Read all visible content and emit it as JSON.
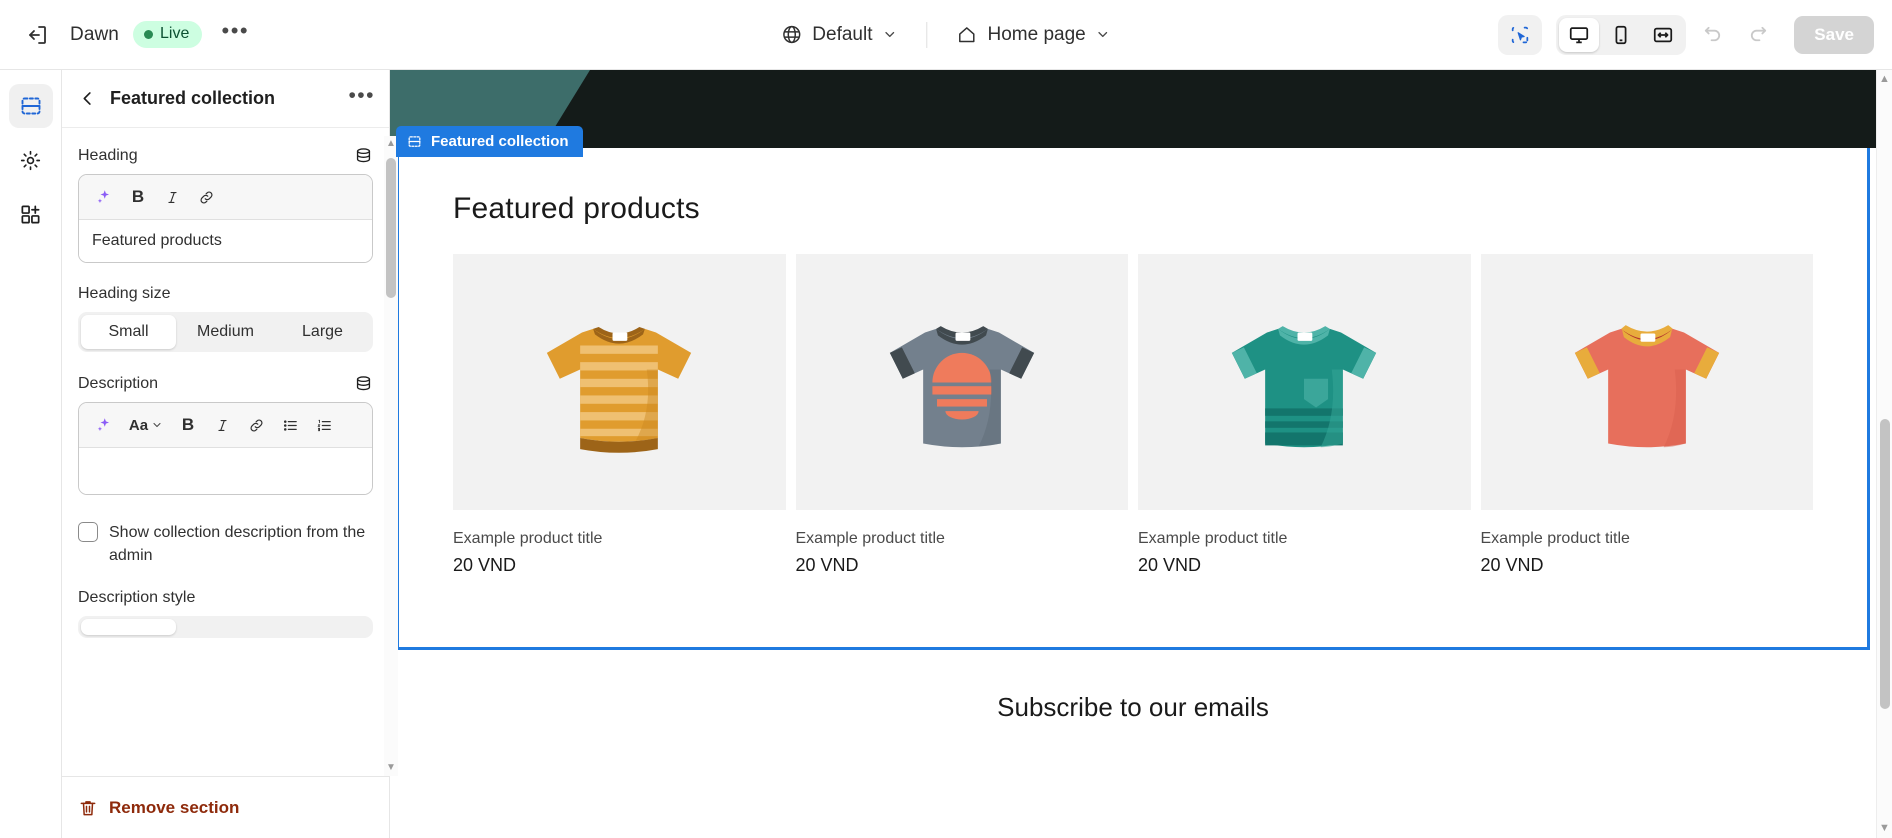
{
  "topbar": {
    "exit_icon": "exit-icon",
    "theme_name": "Dawn",
    "status_badge": "Live",
    "more_menu": "•••",
    "locale_icon": "globe-icon",
    "locale_label": "Default",
    "page_icon": "home-icon",
    "page_label": "Home page",
    "chevron": "⌄",
    "select_tool_icon": "select-tool-icon",
    "device_desktop_icon": "desktop-icon",
    "device_mobile_icon": "mobile-icon",
    "device_fullwidth_icon": "fullwidth-icon",
    "undo_icon": "undo-icon",
    "redo_icon": "redo-icon",
    "save_label": "Save",
    "active_device": "desktop"
  },
  "rail": {
    "items": [
      {
        "name": "sections-icon",
        "label": "Sections",
        "active": true
      },
      {
        "name": "gear-icon",
        "label": "Theme settings",
        "active": false
      },
      {
        "name": "apps-grid-plus-icon",
        "label": "Apps",
        "active": false
      }
    ]
  },
  "sidebar": {
    "back_icon": "chevron-left-icon",
    "title": "Featured collection",
    "more_icon": "ellipsis-icon",
    "heading": {
      "label": "Heading",
      "source_icon": "database-icon",
      "toolbar": [
        "sparkle-icon",
        "bold-icon",
        "italic-icon",
        "link-icon"
      ],
      "value": "Featured products"
    },
    "heading_size": {
      "label": "Heading size",
      "options": [
        "Small",
        "Medium",
        "Large"
      ],
      "selected": "Small"
    },
    "description": {
      "label": "Description",
      "source_icon": "database-icon",
      "toolbar": [
        "sparkle-icon",
        "Aa",
        "chevron-down-icon",
        "bold-icon",
        "italic-icon",
        "link-icon",
        "bullet-list-icon",
        "numbered-list-icon"
      ],
      "value": ""
    },
    "show_collection_description": {
      "label": "Show collection description from the admin",
      "checked": false
    },
    "description_style": {
      "label": "Description style"
    },
    "footer": {
      "trash_icon": "trash-icon",
      "remove_label": "Remove section"
    }
  },
  "preview": {
    "section_badge": {
      "icon": "section-icon",
      "label": "Featured collection"
    },
    "featured_title": "Featured products",
    "products": [
      {
        "title": "Example product title",
        "price": "20 VND",
        "shirt": "orange-striped-tshirt"
      },
      {
        "title": "Example product title",
        "price": "20 VND",
        "shirt": "gray-sunset-tshirt"
      },
      {
        "title": "Example product title",
        "price": "20 VND",
        "shirt": "teal-pocket-tshirt"
      },
      {
        "title": "Example product title",
        "price": "20 VND",
        "shirt": "red-tshirt"
      }
    ],
    "newsletter_heading": "Subscribe to our emails"
  },
  "colors": {
    "accent_blue": "#1f7ae0",
    "live_green_bg": "#cdfee1",
    "live_green_text": "#0c5132",
    "remove_red": "#8e2a0b",
    "header_dark": "#141b19",
    "header_teal": "#3d6d6a",
    "card_bg": "#f2f2f2"
  }
}
